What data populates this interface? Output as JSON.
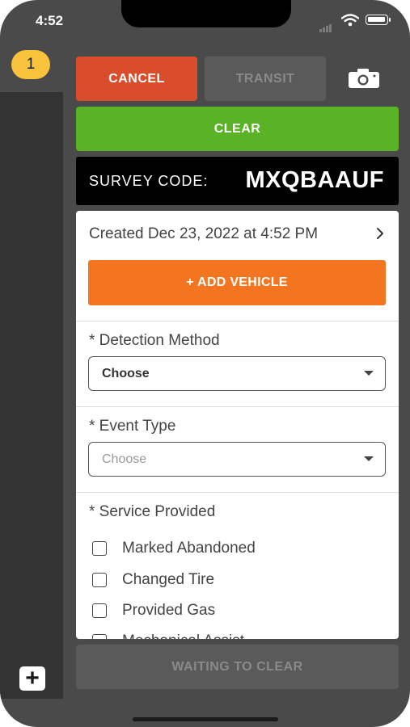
{
  "status_bar": {
    "time": "4:52"
  },
  "sidebar": {
    "count_badge": "1",
    "add_button_glyph": "+"
  },
  "toolbar": {
    "cancel_label": "CANCEL",
    "transit_label": "TRANSIT",
    "camera_icon": "camera-icon"
  },
  "clear_label": "CLEAR",
  "survey": {
    "label": "SURVEY CODE:",
    "code": "MXQBAAUF"
  },
  "event": {
    "created_text": "Created Dec 23, 2022 at 4:52 PM",
    "add_vehicle_label": "+ ADD VEHICLE",
    "detection_method": {
      "label": "* Detection Method",
      "value": "Choose"
    },
    "event_type": {
      "label": "* Event Type",
      "placeholder": "Choose"
    },
    "service_provided": {
      "label": "* Service Provided",
      "options": [
        {
          "label": "Marked Abandoned",
          "checked": false
        },
        {
          "label": "Changed Tire",
          "checked": false
        },
        {
          "label": "Provided Gas",
          "checked": false
        },
        {
          "label": "Mechanical Assist",
          "checked": false
        }
      ]
    }
  },
  "footer": {
    "waiting_label": "WAITING TO CLEAR"
  },
  "colors": {
    "cancel": "#d94d2c",
    "clear": "#5ab227",
    "add_vehicle": "#f47520",
    "badge": "#f8c33b",
    "disabled": "#5a5a5a",
    "frame": "#4a4a4a"
  }
}
